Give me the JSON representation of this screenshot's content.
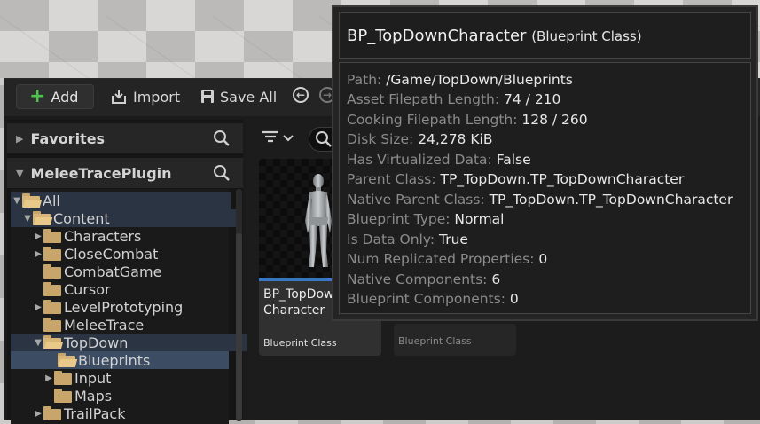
{
  "toolbar": {
    "add_label": "Add",
    "import_label": "Import",
    "save_all_label": "Save All"
  },
  "sidebar": {
    "favorites_label": "Favorites",
    "plugin_label": "MeleeTracePlugin",
    "tree": [
      {
        "label": "All"
      },
      {
        "label": "Content"
      },
      {
        "label": "Characters"
      },
      {
        "label": "CloseCombat"
      },
      {
        "label": "CombatGame"
      },
      {
        "label": "Cursor"
      },
      {
        "label": "LevelPrototyping"
      },
      {
        "label": "MeleeTrace"
      },
      {
        "label": "TopDown"
      },
      {
        "label": "Blueprints"
      },
      {
        "label": "Input"
      },
      {
        "label": "Maps"
      },
      {
        "label": "TrailPack"
      }
    ]
  },
  "assets": [
    {
      "name_line1": "BP_TopDow",
      "name_line2": "Character",
      "class_label": "Blueprint Class"
    },
    {
      "class_label": "Blueprint Class"
    }
  ],
  "tooltip": {
    "title": "BP_TopDownCharacter",
    "subtitle": "(Blueprint Class)",
    "rows": [
      {
        "key": "Path: ",
        "value": "/Game/TopDown/Blueprints"
      },
      {
        "key": "Asset Filepath Length: ",
        "value": "74 / 210"
      },
      {
        "key": "Cooking Filepath Length: ",
        "value": "128 / 260"
      },
      {
        "key": "Disk Size: ",
        "value": "24,278 KiB"
      },
      {
        "key": "Has Virtualized Data: ",
        "value": "False"
      },
      {
        "key": "Parent Class: ",
        "value": "TP_TopDown.TP_TopDownCharacter"
      },
      {
        "key": "Native Parent Class: ",
        "value": "TP_TopDown.TP_TopDownCharacter"
      },
      {
        "key": "Blueprint Type: ",
        "value": "Normal"
      },
      {
        "key": "Is Data Only: ",
        "value": "True"
      },
      {
        "key": "Num Replicated Properties: ",
        "value": "0"
      },
      {
        "key": "Native Components: ",
        "value": "6"
      },
      {
        "key": "Blueprint Components: ",
        "value": "0"
      }
    ]
  },
  "colors": {
    "accent_green": "#4ec24e",
    "selection_blue": "#3b4c63",
    "asset_bar_blue": "#3a78c7",
    "folder_gold": "#c8a56a"
  }
}
